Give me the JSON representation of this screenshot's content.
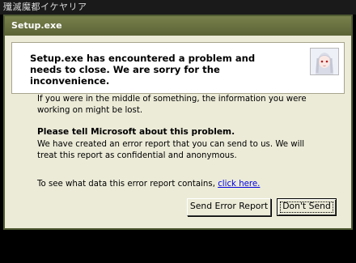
{
  "background": {
    "window_title": "殲滅魔都イケヤリア"
  },
  "dialog": {
    "title": "Setup.exe",
    "header_message": "Setup.exe has encountered a problem and needs to close.  We are sorry for the inconvenience.",
    "info_text": "If you were in the middle of something, the information you were working on might be lost.",
    "report_heading": "Please tell Microsoft about this problem.",
    "report_text": "We have created an error report that you can send to us.  We will treat this report as confidential and anonymous.",
    "data_prompt": "To see what data this error report contains, ",
    "data_link": "click here.",
    "buttons": {
      "send": "Send Error Report",
      "dont_send": "Don't Send"
    }
  },
  "colors": {
    "titlebar": "#5b6336",
    "dialog_bg": "#ecebd8",
    "link": "#0000e0"
  },
  "icons": {
    "header_image": "anime-character-portrait"
  }
}
